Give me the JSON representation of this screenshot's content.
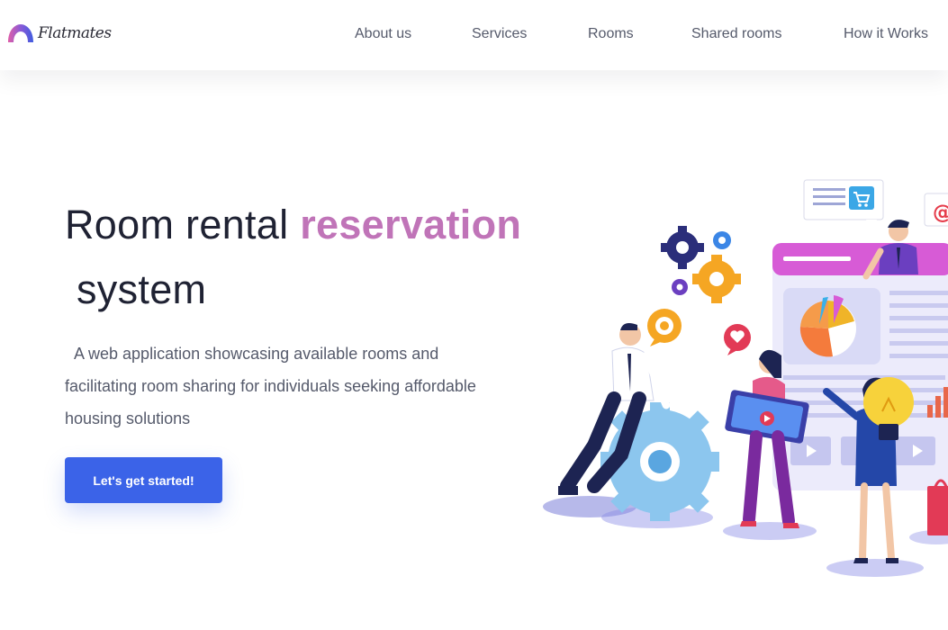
{
  "brand": {
    "name": "Flatmates"
  },
  "nav": {
    "items": [
      {
        "label": "About us"
      },
      {
        "label": "Services"
      },
      {
        "label": "Rooms"
      },
      {
        "label": "Shared rooms"
      },
      {
        "label": "How it Works"
      }
    ]
  },
  "hero": {
    "title_part1": "Room rental ",
    "title_accent": "reservation",
    "title_part2": "system",
    "description_line1": "A web application showcasing available rooms and",
    "description_line2": "facilitating room sharing for individuals seeking affordable",
    "description_line3": "housing solutions",
    "cta_label": "Let's get started!"
  },
  "colors": {
    "accent": "#c074b8",
    "primary_button": "#3b63e8"
  },
  "illustration": {
    "name": "team-collaboration-illustration"
  }
}
